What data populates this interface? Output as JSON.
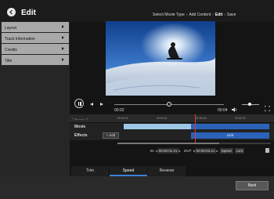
{
  "header": {
    "title": "Edit",
    "breadcrumb": [
      "Select Movie Type",
      "Add Content",
      "Edit",
      "Save"
    ],
    "breadcrumb_current": "Edit"
  },
  "sidebar": {
    "items": [
      {
        "label": "Layout"
      },
      {
        "label": "Track Information"
      },
      {
        "label": "Credits"
      },
      {
        "label": "Title"
      }
    ]
  },
  "player": {
    "time_current": "00:02",
    "time_total": "00:04",
    "position_fraction": 0.5,
    "volume_fraction": 0.45
  },
  "timeline": {
    "zoom_label": "− •——— +",
    "ruler_ticks": [
      "00:00:00",
      "00:00:01",
      "00:00:02",
      "00:00:03"
    ],
    "tracks": {
      "movie_label": "Movie",
      "effects_label": "Effects"
    },
    "add_label": "+ Add",
    "effect_clip_label": "x1/4"
  },
  "inout": {
    "in_label": "IN",
    "in_value": "00:00:01.21",
    "out_label": "OUT",
    "out_value": "00:00:03.21",
    "speed_label": "Speed",
    "speed_value": "x1/4"
  },
  "tabs": [
    {
      "label": "Trim"
    },
    {
      "label": "Speed"
    },
    {
      "label": "Reverse"
    }
  ],
  "active_tab": "Speed",
  "footer": {
    "next_label": "Next"
  },
  "colors": {
    "accent": "#2b63b8",
    "playhead": "#e33333",
    "clip_light": "#9cc8e6"
  }
}
